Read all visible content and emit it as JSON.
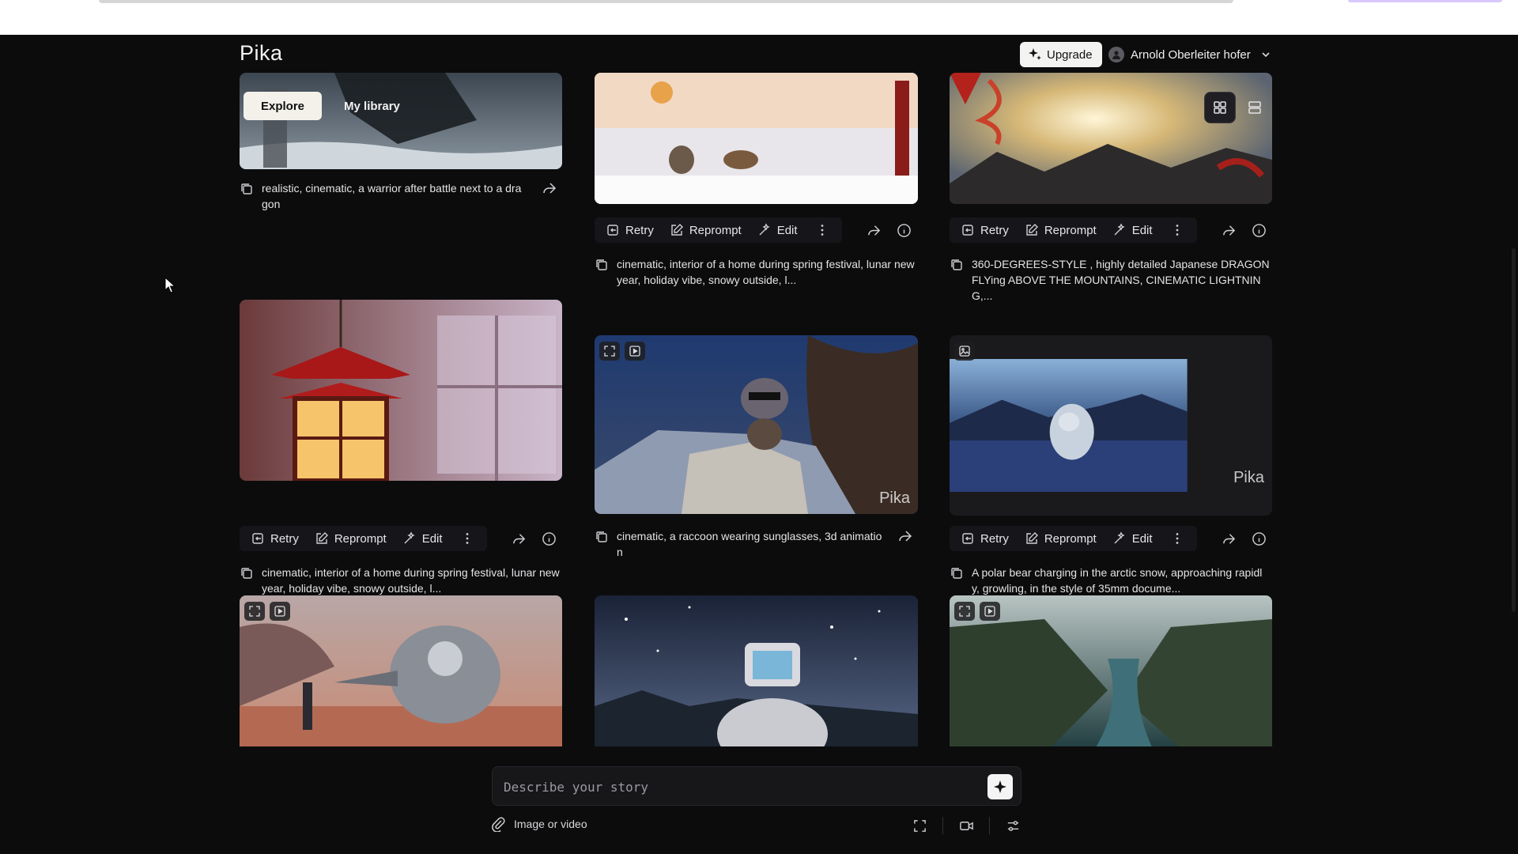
{
  "header": {
    "logo": "Pika",
    "upgrade_label": "Upgrade",
    "user_name": "Arnold Oberleiter hofer"
  },
  "tabs": [
    {
      "label": "Explore",
      "active": true
    },
    {
      "label": "My library",
      "active": false
    }
  ],
  "actions": {
    "retry": "Retry",
    "reprompt": "Reprompt",
    "edit": "Edit"
  },
  "watermark": "Pika",
  "cards": [
    {
      "caption": "realistic, cinematic, a warrior after battle next to a dra gon"
    },
    {
      "caption": "cinematic, interior of a home during spring festival, lunar new year, holiday vibe, snowy outside, l..."
    },
    {
      "caption": "360-DEGREES-STYLE , highly detailed Japanese DRAGON FLYing ABOVE THE MOUNTAINS, CINEMATIC LIGHTNIN G,..."
    },
    {
      "caption": "cinematic, interior of a home during spring festival, lunar new year, holiday vibe, snowy outside, l..."
    },
    {
      "caption": "cinematic, a raccoon wearing sunglasses, 3d animatio n"
    },
    {
      "caption": "A polar bear charging in the arctic snow, approaching rapidl y, growling, in the style of 35mm docume..."
    }
  ],
  "composer": {
    "placeholder": "Describe your story",
    "attach_label": "Image or video"
  },
  "colors": {
    "background": "#0c0c0d",
    "upgrade_bg": "#f3f3f1",
    "tab_active_bg": "#f4f1ea"
  }
}
